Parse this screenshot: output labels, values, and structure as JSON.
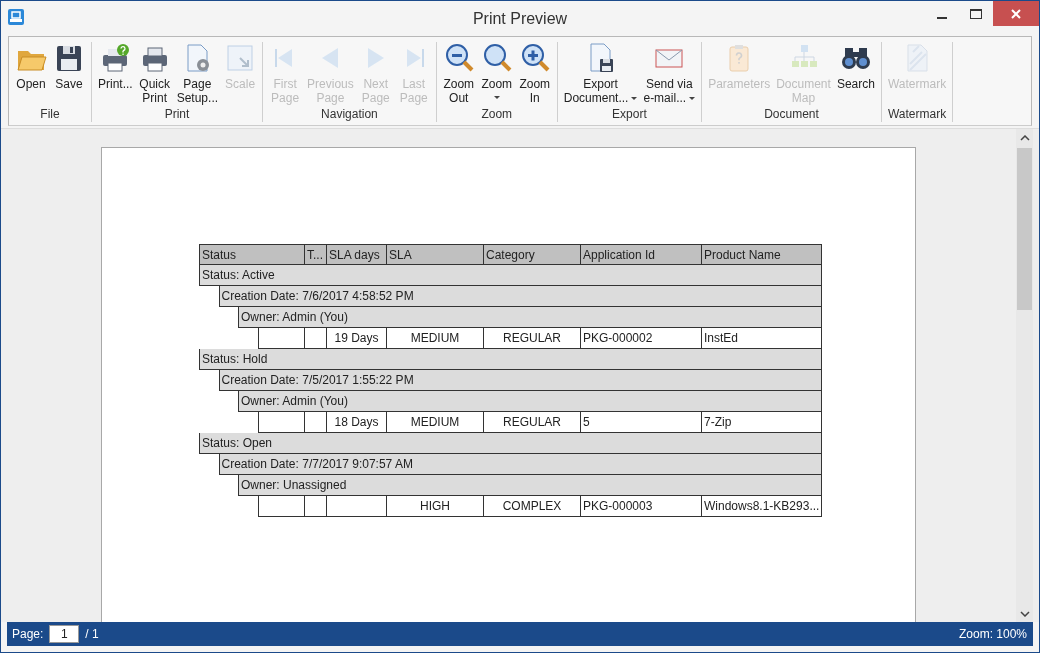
{
  "window": {
    "title": "Print Preview"
  },
  "ribbon": {
    "groups": [
      {
        "label": "File",
        "buttons": [
          {
            "label": "Open",
            "disabled": false,
            "dropdown": false
          },
          {
            "label": "Save",
            "disabled": false,
            "dropdown": false
          }
        ]
      },
      {
        "label": "Print",
        "buttons": [
          {
            "label": "Print...",
            "disabled": false,
            "dropdown": false
          },
          {
            "label": "Quick\nPrint",
            "disabled": false,
            "dropdown": false
          },
          {
            "label": "Page\nSetup...",
            "disabled": false,
            "dropdown": false
          },
          {
            "label": "Scale",
            "disabled": true,
            "dropdown": false
          }
        ]
      },
      {
        "label": "Navigation",
        "buttons": [
          {
            "label": "First\nPage",
            "disabled": true,
            "dropdown": false
          },
          {
            "label": "Previous\nPage",
            "disabled": true,
            "dropdown": false
          },
          {
            "label": "Next\nPage",
            "disabled": true,
            "dropdown": false
          },
          {
            "label": "Last\nPage",
            "disabled": true,
            "dropdown": false
          }
        ]
      },
      {
        "label": "Zoom",
        "buttons": [
          {
            "label": "Zoom\nOut",
            "disabled": false,
            "dropdown": false
          },
          {
            "label": "Zoom",
            "disabled": false,
            "dropdown": true
          },
          {
            "label": "Zoom\nIn",
            "disabled": false,
            "dropdown": false
          }
        ]
      },
      {
        "label": "Export",
        "buttons": [
          {
            "label": "Export\nDocument...",
            "disabled": false,
            "dropdown": true
          },
          {
            "label": "Send via\ne-mail...",
            "disabled": false,
            "dropdown": true
          }
        ]
      },
      {
        "label": "Document",
        "buttons": [
          {
            "label": "Parameters",
            "disabled": true,
            "dropdown": false
          },
          {
            "label": "Document\nMap",
            "disabled": true,
            "dropdown": false
          },
          {
            "label": "Search",
            "disabled": false,
            "dropdown": false
          }
        ]
      },
      {
        "label": "Watermark",
        "buttons": [
          {
            "label": "Watermark",
            "disabled": true,
            "dropdown": false
          }
        ]
      }
    ]
  },
  "report": {
    "columns": [
      "Status",
      "T...",
      "SLA days",
      "SLA",
      "Category",
      "Application Id",
      "Product Name"
    ],
    "groups": [
      {
        "label": "Status: Active",
        "children": [
          {
            "label": "Creation Date: 7/6/2017 4:58:52 PM",
            "children": [
              {
                "label": "Owner: Admin (You)",
                "rows": [
                  {
                    "sla_days": "19 Days",
                    "sla": "MEDIUM",
                    "category": "REGULAR",
                    "application_id": "PKG-000002",
                    "product_name": "InstEd"
                  }
                ]
              }
            ]
          }
        ]
      },
      {
        "label": "Status: Hold",
        "children": [
          {
            "label": "Creation Date: 7/5/2017 1:55:22 PM",
            "children": [
              {
                "label": "Owner: Admin (You)",
                "rows": [
                  {
                    "sla_days": "18 Days",
                    "sla": "MEDIUM",
                    "category": "REGULAR",
                    "application_id": "5",
                    "product_name": "7-Zip"
                  }
                ]
              }
            ]
          }
        ]
      },
      {
        "label": "Status: Open",
        "children": [
          {
            "label": "Creation Date: 7/7/2017 9:07:57 AM",
            "children": [
              {
                "label": "Owner: Unassigned",
                "rows": [
                  {
                    "sla": "HIGH",
                    "category": "COMPLEX",
                    "application_id": "PKG-000003",
                    "product_name": "Windows8.1-KB293..."
                  }
                ]
              }
            ]
          }
        ]
      }
    ]
  },
  "status_bar": {
    "page_label": "Page:",
    "page_value": "1",
    "page_total": "/ 1",
    "zoom": "Zoom: 100%"
  }
}
